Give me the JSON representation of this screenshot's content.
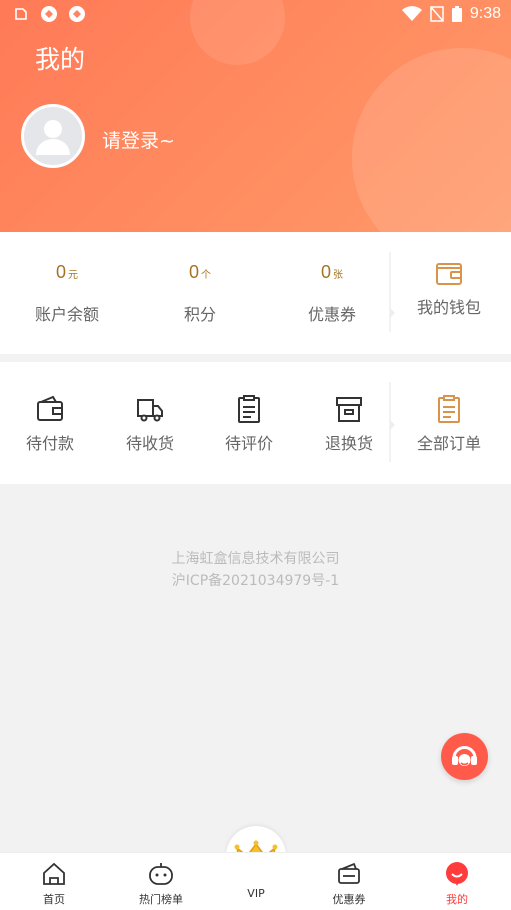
{
  "status_bar": {
    "time": "9:38"
  },
  "header": {
    "title": "我的",
    "login_prompt": "请登录~"
  },
  "stats": [
    {
      "value": "0",
      "unit": "元",
      "label": "账户余额"
    },
    {
      "value": "0",
      "unit": "个",
      "label": "积分"
    },
    {
      "value": "0",
      "unit": "张",
      "label": "优惠券"
    }
  ],
  "wallet": {
    "label": "我的钱包"
  },
  "orders": [
    {
      "label": "待付款",
      "icon": "wallet-icon"
    },
    {
      "label": "待收货",
      "icon": "truck-icon"
    },
    {
      "label": "待评价",
      "icon": "clipboard-icon"
    },
    {
      "label": "退换货",
      "icon": "box-icon"
    }
  ],
  "all_orders": {
    "label": "全部订单"
  },
  "footer": {
    "company": "上海虹盒信息技术有限公司",
    "icp": "沪ICP备2021034979号-1"
  },
  "tabbar": [
    {
      "label": "首页"
    },
    {
      "label": "热门榜单"
    },
    {
      "label": "VIP"
    },
    {
      "label": "优惠券"
    },
    {
      "label": "我的"
    }
  ],
  "colors": {
    "header": "#ff8560",
    "accent": "#a47424",
    "active_tab": "#ff3b3b"
  }
}
